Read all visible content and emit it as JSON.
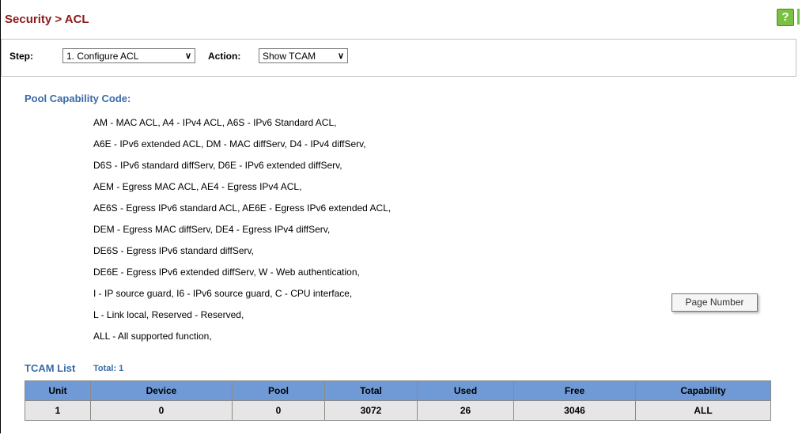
{
  "header": {
    "title": "Security > ACL",
    "help_icon": "?"
  },
  "controls": {
    "step_label": "Step:",
    "step_value": "1. Configure ACL",
    "action_label": "Action:",
    "action_value": "Show TCAM"
  },
  "pool": {
    "title": "Pool Capability Code:",
    "lines": [
      "AM - MAC ACL, A4 - IPv4 ACL, A6S - IPv6 Standard ACL,",
      "A6E - IPv6 extended ACL, DM - MAC diffServ, D4 - IPv4 diffServ,",
      "D6S - IPv6 standard diffServ, D6E - IPv6 extended diffServ,",
      "AEM - Egress MAC ACL, AE4 - Egress IPv4 ACL,",
      "AE6S - Egress IPv6 standard ACL, AE6E - Egress IPv6 extended ACL,",
      "DEM - Egress MAC diffServ, DE4 - Egress IPv4 diffServ,",
      "DE6S - Egress IPv6 standard diffServ,",
      "DE6E - Egress IPv6 extended diffServ, W - Web authentication,",
      "I - IP source guard, I6 - IPv6 source guard, C - CPU interface,",
      "L - Link local, Reserved - Reserved,",
      "ALL - All supported function,"
    ]
  },
  "tooltip": "Page Number",
  "tcam": {
    "title": "TCAM List",
    "total": "Total: 1",
    "columns": [
      "Unit",
      "Device",
      "Pool",
      "Total",
      "Used",
      "Free",
      "Capability"
    ],
    "rows": [
      [
        "1",
        "0",
        "0",
        "3072",
        "26",
        "3046",
        "ALL"
      ]
    ]
  },
  "colors": {
    "title": "#8b1a1a",
    "accent": "#3a6aa8",
    "table_header": "#6f9ad6",
    "help": "#7ac143"
  }
}
